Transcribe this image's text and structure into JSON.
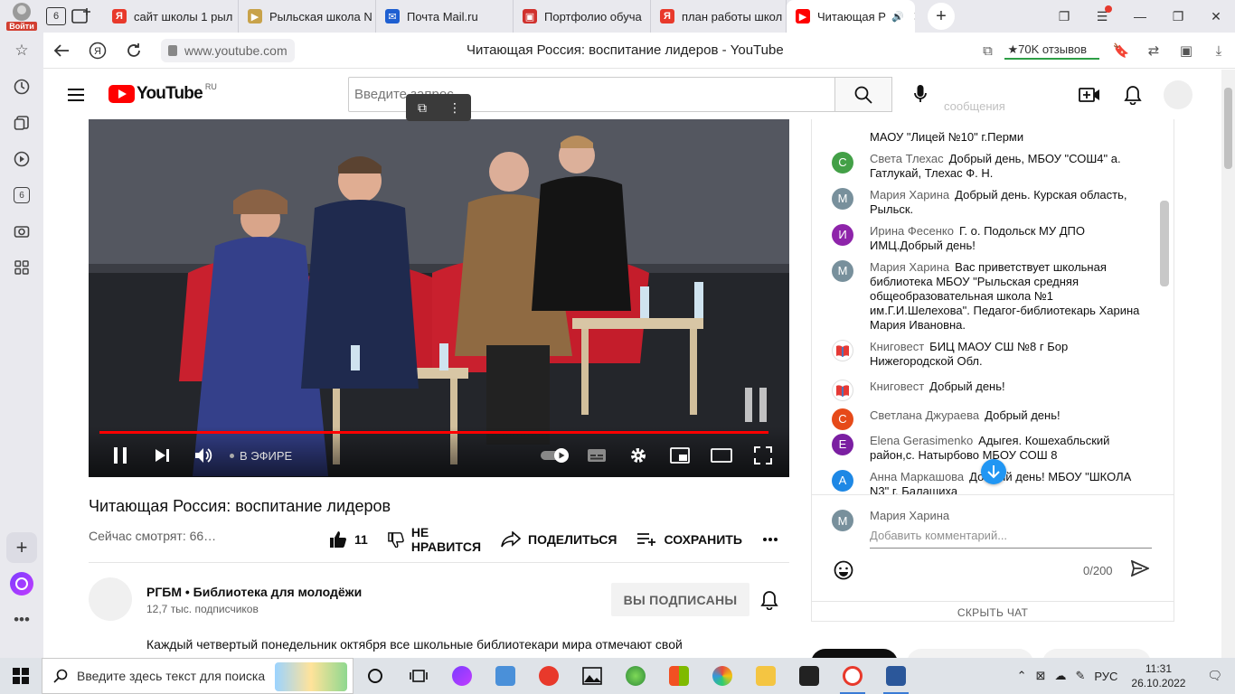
{
  "browser": {
    "profile_label": "Войти",
    "tab_counter": "6",
    "tabs": [
      {
        "label": "сайт школы 1 рыл",
        "fav_color": "#e8392b",
        "fav_glyph": "Я"
      },
      {
        "label": "Рыльская школа N",
        "fav_color": "#c8a24a",
        "fav_glyph": "▶"
      },
      {
        "label": "Почта Mail.ru",
        "fav_color": "#1e5fd1",
        "fav_glyph": "✉"
      },
      {
        "label": "Портфолио обуча",
        "fav_color": "#d0312d",
        "fav_glyph": "▣"
      },
      {
        "label": "план работы школ",
        "fav_color": "#e8392b",
        "fav_glyph": "Я"
      },
      {
        "label": "Читающая Р",
        "fav_color": "#ff0000",
        "fav_glyph": "▶"
      }
    ],
    "url": "www.youtube.com",
    "page_title": "Читающая Россия: воспитание лидеров - YouTube",
    "reviews": "★70K отзывов"
  },
  "youtube": {
    "logo_text": "YouTube",
    "country_code": "RU",
    "search_placeholder": "Введите запрос",
    "video": {
      "title": "Читающая Россия: воспитание лидеров",
      "watching": "Сейчас смотрят: 66…",
      "live_label": "В ЭФИРЕ",
      "likes": "11",
      "dislike_label_1": "НЕ",
      "dislike_label_2": "НРАВИТСЯ",
      "share_label": "ПОДЕЛИТЬСЯ",
      "save_label": "СОХРАНИТЬ",
      "progress": 0.985
    },
    "channel": {
      "name": "РГБМ • Библиотека для молодёжи",
      "subscribers": "12,7 тыс. подписчиков",
      "subscribe_label": "ВЫ ПОДПИСАНЫ",
      "description": "Каждый четвертый понедельник октября все школьные библиотекари мира отмечают свой"
    },
    "chat": {
      "header_ghost": "сообщения",
      "messages": [
        {
          "author": "",
          "initial": "",
          "color": "#ffffff",
          "text": "МАОУ \"Лицей №10\" г.Перми"
        },
        {
          "author": "Света Тлехас",
          "initial": "С",
          "color": "#43a047",
          "text": "Добрый день, МБОУ \"СОШ4\" а. Гатлукай, Тлехас Ф. Н."
        },
        {
          "author": "Мария Харина",
          "initial": "М",
          "color": "#78909c",
          "text": "Добрый день. Курская область, Рыльск."
        },
        {
          "author": "Ирина Фесенко",
          "initial": "И",
          "color": "#8e24aa",
          "text": "Г. о. Подольск МУ ДПО ИМЦ.Добрый день!"
        },
        {
          "author": "Мария Харина",
          "initial": "М",
          "color": "#78909c",
          "text": "Вас приветствует школьная библиотека МБОУ \"Рыльская средняя общеобразовательная школа №1 им.Г.И.Шелехова\". Педагог-библиотекарь Харина Мария Ивановна."
        },
        {
          "author": "Книговест",
          "initial": "",
          "color": "#ffffff",
          "text": "БИЦ МАОУ СШ №8 г Бор Нижегородской Обл."
        },
        {
          "author": "Книговест",
          "initial": "",
          "color": "#ffffff",
          "text": "Добрый день!"
        },
        {
          "author": "Светлана Джураева",
          "initial": "С",
          "color": "#e64a19",
          "text": "Добрый день!"
        },
        {
          "author": "Elena Gerasimenko",
          "initial": "E",
          "color": "#7b1fa2",
          "text": "Адыгея. Кошехабльский район,с. Натырбово МБОУ СОШ 8"
        },
        {
          "author": "Анна Маркашова",
          "initial": "А",
          "color": "#1e88e5",
          "text": "Добрый день! МБОУ \"ШКОЛА N3\" г. Балашиха"
        }
      ],
      "input_author": "Мария Харина",
      "input_initial": "М",
      "input_placeholder": "Добавить комментарий...",
      "char_count": "0/200",
      "hide_label": "СКРЫТЬ ЧАТ"
    }
  },
  "taskbar": {
    "search_placeholder": "Введите здесь текст для поиска",
    "lang": "РУС",
    "time": "11:31",
    "date": "26.10.2022"
  }
}
